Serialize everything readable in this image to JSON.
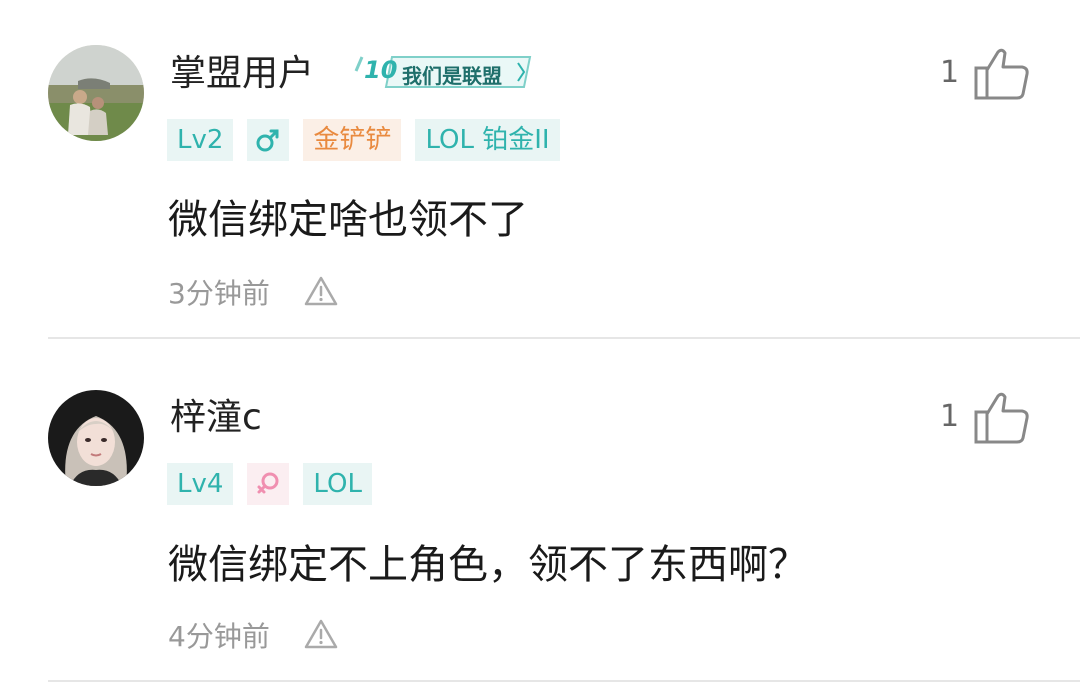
{
  "comments": [
    {
      "username": "掌盟用户",
      "medal_text": "我们是联盟",
      "medal_number": "10",
      "badges": {
        "level": "Lv2",
        "gender": "male",
        "rank": "金铲铲",
        "game": "LOL 铂金II"
      },
      "text": "微信绑定啥也领不了",
      "time": "3分钟前",
      "likes": "1"
    },
    {
      "username": "梓潼c",
      "badges": {
        "level": "Lv4",
        "gender": "female",
        "game": "LOL"
      },
      "text": "微信绑定不上角色，领不了东西啊？",
      "time": "4分钟前",
      "likes": "1"
    }
  ],
  "colors": {
    "teal": "#2fb3ad",
    "teal_bg": "#e9f5f4",
    "orange": "#e98a3f",
    "orange_bg": "#fbefe6",
    "pink": "#f08fb0",
    "gray_text": "#999999"
  },
  "icons": [
    "male-icon",
    "female-icon",
    "report-warning-icon",
    "thumbs-up-icon"
  ]
}
